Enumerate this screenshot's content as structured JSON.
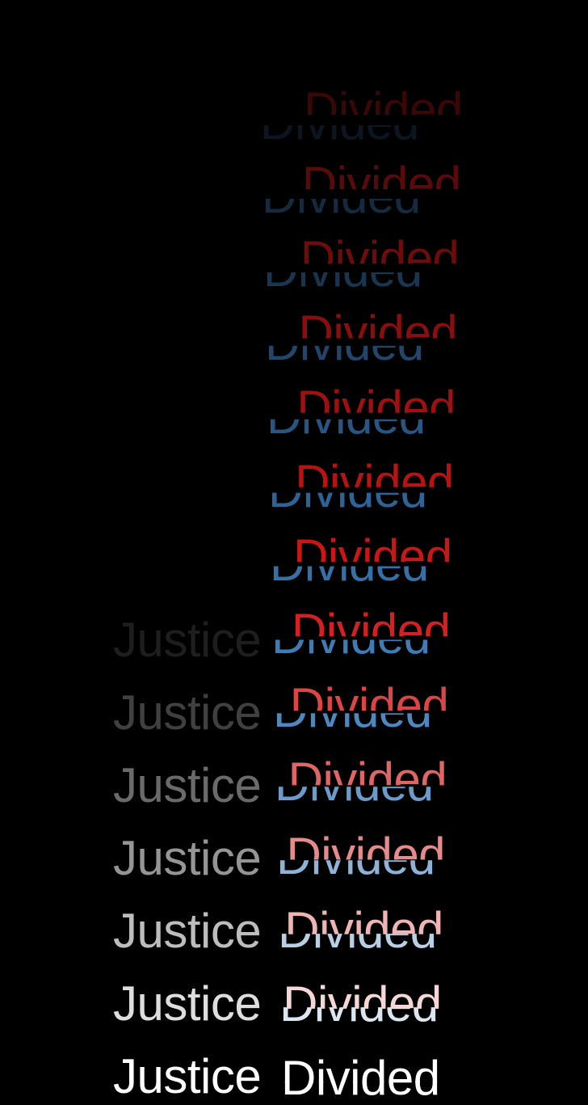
{
  "title": {
    "word1": "Justice",
    "word2": "Divided"
  },
  "colors": {
    "background": "#000000",
    "red_final": "#ffffff",
    "blue_final": "#ffffff"
  },
  "frames": [
    {
      "justice": "",
      "red": "#3a0707",
      "blue": "#0d1620"
    },
    {
      "justice": "",
      "red": "#5a0a0a",
      "blue": "#152a3e"
    },
    {
      "justice": "",
      "red": "#6e0c0c",
      "blue": "#1a3550"
    },
    {
      "justice": "",
      "red": "#8a0e0e",
      "blue": "#224569"
    },
    {
      "justice": "",
      "red": "#a01010",
      "blue": "#285582"
    },
    {
      "justice": "",
      "red": "#b81313",
      "blue": "#2e6396"
    },
    {
      "justice": "",
      "red": "#cc1616",
      "blue": "#3570a8"
    },
    {
      "justice": "#1e1e1e",
      "red": "#d42020",
      "blue": "#3d7cb5"
    },
    {
      "justice": "#404040",
      "red": "#dc4545",
      "blue": "#4d89c0"
    },
    {
      "justice": "#6a6a6a",
      "red": "#e06565",
      "blue": "#6a9ccb"
    },
    {
      "justice": "#959595",
      "red": "#e68a8a",
      "blue": "#8fb3d6"
    },
    {
      "justice": "#bdbdbd",
      "red": "#efb4b4",
      "blue": "#b9cfe4"
    },
    {
      "justice": "#dedede",
      "red": "#f6d7d7",
      "blue": "#dbe6f1"
    },
    {
      "justice": "#ffffff",
      "red": "#ffffff",
      "blue": "#ffffff"
    }
  ]
}
